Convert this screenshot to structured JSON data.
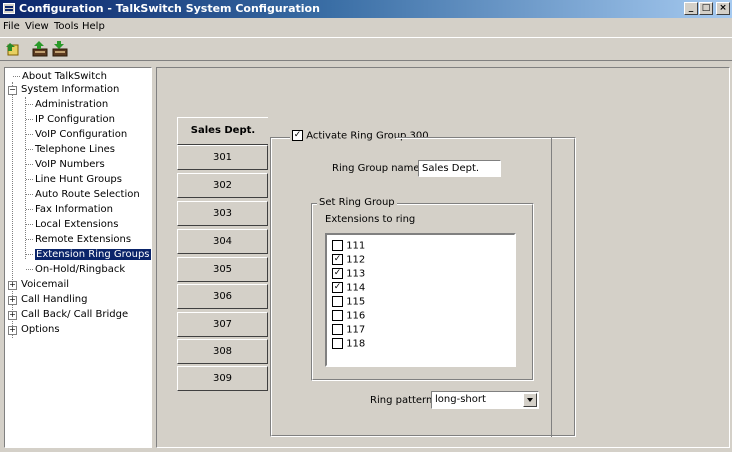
{
  "window": {
    "title": "Configuration - TalkSwitch System Configuration",
    "minimize": "_",
    "maximize": "□",
    "close": "×"
  },
  "menu": [
    "File",
    "View",
    "Tools",
    "Help"
  ],
  "toolbar": {
    "icons": [
      "open-icon",
      "upload-icon",
      "download-icon"
    ]
  },
  "tree": {
    "items": [
      {
        "label": "About TalkSwitch"
      },
      {
        "label": "System Information",
        "expander": "−"
      },
      {
        "label": "Administration"
      },
      {
        "label": "IP Configuration"
      },
      {
        "label": "VoIP Configuration"
      },
      {
        "label": "Telephone Lines"
      },
      {
        "label": "VoIP Numbers"
      },
      {
        "label": "Line Hunt Groups"
      },
      {
        "label": "Auto Route Selection"
      },
      {
        "label": "Fax Information"
      },
      {
        "label": "Local Extensions"
      },
      {
        "label": "Remote Extensions"
      },
      {
        "label": "Extension Ring Groups",
        "selected": true
      },
      {
        "label": "On-Hold/Ringback"
      },
      {
        "label": "Voicemail",
        "expander": "+"
      },
      {
        "label": "Call Handling",
        "expander": "+"
      },
      {
        "label": "Call Back/ Call Bridge",
        "expander": "+"
      },
      {
        "label": "Options",
        "expander": "+"
      }
    ]
  },
  "tabs": [
    "Sales Dept.",
    "301",
    "302",
    "303",
    "304",
    "305",
    "306",
    "307",
    "308",
    "309"
  ],
  "ring_group": {
    "activate_label": "Activate Ring Group 300",
    "activate_checked": true,
    "name_label": "Ring Group name:",
    "name_value": "Sales Dept.",
    "set_group_legend": "Set Ring Group",
    "extensions_label": "Extensions to ring",
    "extensions": [
      {
        "num": "111",
        "checked": false
      },
      {
        "num": "112",
        "checked": true
      },
      {
        "num": "113",
        "checked": true
      },
      {
        "num": "114",
        "checked": true
      },
      {
        "num": "115",
        "checked": false
      },
      {
        "num": "116",
        "checked": false
      },
      {
        "num": "117",
        "checked": false
      },
      {
        "num": "118",
        "checked": false
      }
    ],
    "pattern_label": "Ring pattern:",
    "pattern_value": "long-short"
  },
  "colors": {
    "titlebar_start": "#0a246a",
    "titlebar_end": "#a6caf0",
    "selection": "#0a246a",
    "face": "#d4d0c8"
  }
}
